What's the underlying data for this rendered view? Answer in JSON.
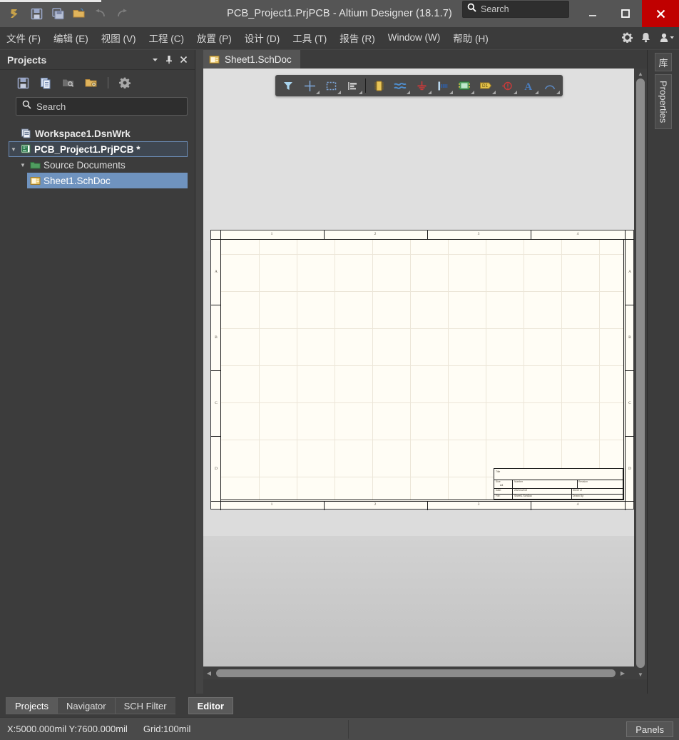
{
  "window": {
    "title": "PCB_Project1.PrjPCB - Altium Designer (18.1.7)",
    "minimize_label": "Minimize",
    "maximize_label": "Maximize",
    "close_label": "Close"
  },
  "quick_access": [
    {
      "name": "altium-logo-icon",
      "label": "Altium"
    },
    {
      "name": "save-icon",
      "label": "Save"
    },
    {
      "name": "save-all-icon",
      "label": "Save All"
    },
    {
      "name": "open-folder-icon",
      "label": "Open"
    },
    {
      "name": "undo-icon",
      "label": "Undo"
    },
    {
      "name": "redo-icon",
      "label": "Redo"
    }
  ],
  "titlebar_search": {
    "placeholder": "Search",
    "value": ""
  },
  "menu": {
    "items": [
      {
        "text": "文件 (F)",
        "cjk": "文件",
        "key": "F"
      },
      {
        "text": "编辑 (E)",
        "cjk": "编辑",
        "key": "E"
      },
      {
        "text": "视图 (V)",
        "cjk": "视图",
        "key": "V"
      },
      {
        "text": "工程 (C)",
        "cjk": "工程",
        "key": "C"
      },
      {
        "text": "放置 (P)",
        "cjk": "放置",
        "key": "P"
      },
      {
        "text": "设计 (D)",
        "cjk": "设计",
        "key": "D"
      },
      {
        "text": "工具 (T)",
        "cjk": "工具",
        "key": "T"
      },
      {
        "text": "报告 (R)",
        "cjk": "报告",
        "key": "R"
      },
      {
        "text": "Window (W)",
        "cjk": "Window",
        "key": "W"
      },
      {
        "text": "帮助 (H)",
        "cjk": "帮助",
        "key": "H"
      }
    ],
    "right_icons": [
      {
        "name": "gear-icon",
        "label": "Preferences"
      },
      {
        "name": "notifications-bell-icon",
        "label": "Notifications"
      },
      {
        "name": "user-account-icon",
        "label": "Account"
      }
    ]
  },
  "projects_panel": {
    "title": "Projects",
    "header_buttons": [
      {
        "name": "panel-dropdown-button",
        "glyph": "▾"
      },
      {
        "name": "panel-pin-button",
        "glyph": "pin"
      },
      {
        "name": "panel-close-button",
        "glyph": "✕"
      }
    ],
    "toolbar": [
      {
        "name": "save-project-icon",
        "label": "Save"
      },
      {
        "name": "copy-documents-icon",
        "label": "Copy"
      },
      {
        "name": "folder-search-icon",
        "label": "Explore"
      },
      {
        "name": "folder-settings-icon",
        "label": "Project Options"
      },
      {
        "name": "panel-settings-gear-icon",
        "label": "Settings"
      }
    ],
    "search": {
      "placeholder": "Search",
      "value": ""
    },
    "tree": [
      {
        "label": "Workspace1.DsnWrk",
        "icon": "workspace-icon",
        "level": 0,
        "expanded": null,
        "selected": false
      },
      {
        "label": "PCB_Project1.PrjPCB *",
        "icon": "project-icon",
        "level": 1,
        "expanded": true,
        "selected": false,
        "focused": true
      },
      {
        "label": "Source Documents",
        "icon": "folder-icon",
        "level": 2,
        "expanded": true,
        "selected": false
      },
      {
        "label": "Sheet1.SchDoc",
        "icon": "schematic-doc-icon",
        "level": 3,
        "expanded": null,
        "selected": true
      }
    ]
  },
  "document_tabs": [
    {
      "label": "Sheet1.SchDoc",
      "icon": "schematic-doc-icon",
      "active": true
    }
  ],
  "schematic_toolbar": [
    {
      "name": "filter-icon",
      "label": "Filter",
      "dropdown": false
    },
    {
      "name": "crosshair-place-icon",
      "label": "Place",
      "dropdown": true
    },
    {
      "name": "selection-rectangle-icon",
      "label": "Select Area",
      "dropdown": true
    },
    {
      "name": "align-left-icon",
      "label": "Align",
      "dropdown": true
    },
    {
      "name": "separator",
      "label": "",
      "dropdown": false
    },
    {
      "name": "place-part-icon",
      "label": "Place Part",
      "dropdown": false
    },
    {
      "name": "place-wire-icon",
      "label": "Place Wire",
      "dropdown": true
    },
    {
      "name": "place-gnd-power-port-icon",
      "label": "Place GND Power Port",
      "dropdown": true
    },
    {
      "name": "place-bus-net-label-icon",
      "label": "Place Net Label",
      "dropdown": true
    },
    {
      "name": "place-sheet-symbol-icon",
      "label": "Place Sheet Symbol",
      "dropdown": true
    },
    {
      "name": "place-port-icon",
      "label": "Place Port",
      "dropdown": true
    },
    {
      "name": "place-no-erc-icon",
      "label": "Place No ERC",
      "dropdown": true
    },
    {
      "name": "place-text-string-icon",
      "label": "Place Text String",
      "dropdown": true
    },
    {
      "name": "place-arc-icon",
      "label": "Place Arc",
      "dropdown": true
    }
  ],
  "sheet": {
    "zones_top": [
      "1",
      "2",
      "3",
      "4"
    ],
    "zones_bottom": [
      "1",
      "2",
      "3",
      "4"
    ],
    "zones_left": [
      "A",
      "B",
      "C",
      "D"
    ],
    "zones_right": [
      "A",
      "B",
      "C",
      "D"
    ],
    "title_block": {
      "title_label": "Title",
      "title_value": "",
      "size_label": "Size",
      "size_value": "A4",
      "number_label": "Number",
      "number_value": "",
      "revision_label": "Revision",
      "revision_value": "",
      "date_label": "Date:",
      "date_value": "2021/12/19",
      "sheet_label": "Sheet   of",
      "sheet_value": "",
      "file_label": "File:",
      "file_value": "Sheet1.SchDoc",
      "drawnby_label": "Drawn By:"
    }
  },
  "scrollbars": {
    "vertical": {
      "name": "canvas-vertical-scrollbar"
    },
    "horizontal": {
      "name": "canvas-horizontal-scrollbar"
    }
  },
  "right_tabs": [
    {
      "label": "库",
      "name": "right-tab-library",
      "cjk": true
    },
    {
      "label": "Properties",
      "name": "right-tab-properties",
      "cjk": false
    }
  ],
  "bottom_tabs": {
    "panel_tabs": [
      {
        "label": "Projects",
        "active": true
      },
      {
        "label": "Navigator",
        "active": false
      },
      {
        "label": "SCH Filter",
        "active": false
      }
    ],
    "editor_tab": {
      "label": "Editor"
    }
  },
  "status_bar": {
    "coordinates": "X:5000.000mil Y:7600.000mil",
    "grid": "Grid:100mil",
    "panels_button": "Panels"
  },
  "colors": {
    "titlebar": "#555555",
    "menubar": "#3b3b3b",
    "panel_bg": "#3c3c3c",
    "close_red": "#c00000",
    "selection_blue": "#6f93bf",
    "sheet_paper": "#fffdf5",
    "canvas_grey": "#dfdfdf",
    "accent_text": "#e6e6e6"
  }
}
